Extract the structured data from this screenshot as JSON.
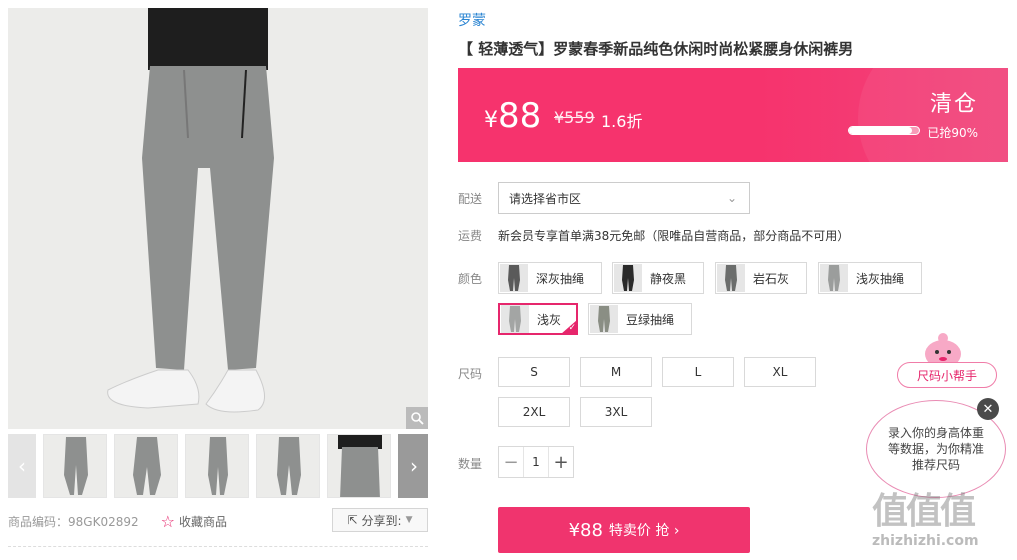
{
  "gallery": {
    "thumb_count": 5,
    "prev_icon": "chevron-left-icon",
    "next_icon": "chevron-right-icon",
    "zoom_icon": "magnifier-icon"
  },
  "meta": {
    "code": "商品编码：98GK02892",
    "favorite_label": "收藏商品",
    "share_label": "分享到:"
  },
  "product": {
    "brand": "罗蒙",
    "title": "【 轻薄透气】罗蒙春季新品纯色休闲时尚松紧腰身休闲裤男"
  },
  "price": {
    "currency": "¥",
    "current": "88",
    "original": "¥559",
    "discount": "1.6折",
    "clearance": "清仓",
    "sold_text": "已抢90%",
    "sold_percent": 90,
    "color_accent": "#f6336d"
  },
  "shipping": {
    "label": "配送",
    "select_value": "请选择省市区",
    "fee_label": "运费",
    "fee_text": "新会员专享首单满38元免邮（限唯品自营商品，部分商品不可用）"
  },
  "colors": {
    "label": "颜色",
    "options": [
      {
        "label": "深灰抽绳",
        "selected": false,
        "tone": "#5a5a5a"
      },
      {
        "label": "静夜黑",
        "selected": false,
        "tone": "#2a2a2a"
      },
      {
        "label": "岩石灰",
        "selected": false,
        "tone": "#6b6d6c"
      },
      {
        "label": "浅灰抽绳",
        "selected": false,
        "tone": "#9b9d9c"
      },
      {
        "label": "浅灰",
        "selected": true,
        "tone": "#a3a5a4"
      },
      {
        "label": "豆绿抽绳",
        "selected": false,
        "tone": "#8a8e84"
      }
    ]
  },
  "sizes": {
    "label": "尺码",
    "options": [
      "S",
      "M",
      "L",
      "XL",
      "2XL",
      "3XL"
    ]
  },
  "quantity": {
    "label": "数量",
    "value": "1",
    "minus": "−",
    "plus": "+"
  },
  "buy": {
    "price": "¥88",
    "label": "特卖价 抢 ›"
  },
  "helper": {
    "tag": "尺码小帮手",
    "bubble": "录入你的身高体重等数据，为你精准推荐尺码",
    "close": "✕"
  },
  "watermark": {
    "text": "值值值",
    "url": "zhizhizhi.com"
  }
}
